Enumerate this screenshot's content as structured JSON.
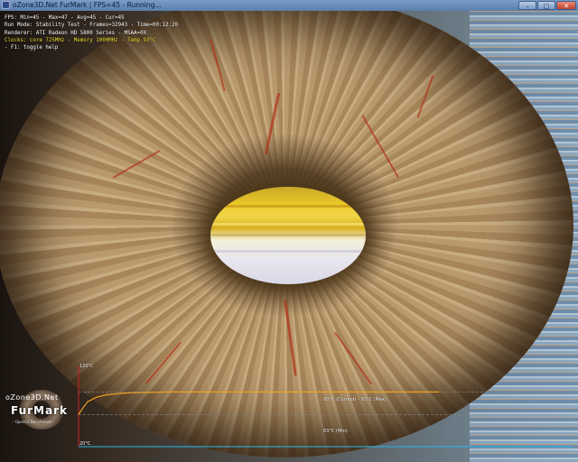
{
  "window": {
    "title": "oZone3D.Net FurMark | FPS=45 - Running...",
    "controls": {
      "minimize": "–",
      "maximize": "□",
      "close": "✕"
    }
  },
  "hud": {
    "fps_line": "FPS: Min=45 - Max=47 - Avg=45 - Cur=45",
    "run_mode_line": "Run Mode: Stability Test - Frames=32943 - Time=00:12:20",
    "renderer_line": "Renderer: ATI Radeon HD 5800 Series - MSAA=0X",
    "clocks_line": "Clocks: core 725MHz - Memory 1000MHz - Temp 93°C",
    "help_line": "- F1: toggle help"
  },
  "logo": {
    "top_text": "oZone3D.Net",
    "main_text": "FurMark",
    "sub_text": "- OpenGL Benchmark -"
  },
  "graph": {
    "y_max_label": "120°C",
    "y_min_label": "20°C",
    "current_label": "93°C (Current) - 93°C (Max)",
    "min_label": "63°C (Min)",
    "colors": {
      "curve": "#f0a020",
      "axis": "#d02020",
      "baseline": "#2ab8e8"
    }
  },
  "chart_data": {
    "type": "line",
    "title": "",
    "xlabel": "",
    "ylabel": "",
    "ylim": [
      20,
      120
    ],
    "x": [
      0,
      5,
      10,
      20,
      30,
      45,
      60,
      80,
      100,
      150,
      200,
      300,
      400
    ],
    "series": [
      {
        "values": [
          63,
          72,
          80,
          86,
          89,
          91,
          92,
          92.5,
          93,
          93,
          93,
          93,
          93
        ]
      }
    ],
    "reference_lines": [
      {
        "value": 93
      },
      {
        "value": 63
      }
    ]
  }
}
